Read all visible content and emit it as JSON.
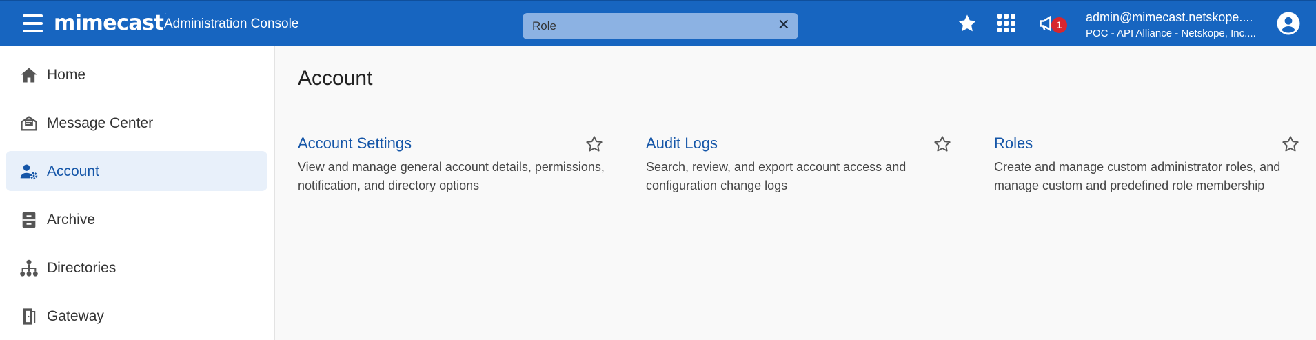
{
  "header": {
    "brand": "mimecast",
    "brand_mark": "·",
    "console_title": "Administration Console",
    "search": {
      "value": "Role",
      "placeholder": ""
    },
    "notification_count": "1",
    "user_email": "admin@mimecast.netskope....",
    "user_org": "POC - API Alliance - Netskope, Inc....",
    "colors": {
      "bar": "#1765c0",
      "search": "#8cb2e3",
      "badge": "#d7262e"
    }
  },
  "sidebar": {
    "items": [
      {
        "label": "Home",
        "icon": "home-icon",
        "active": false
      },
      {
        "label": "Message Center",
        "icon": "message-center-icon",
        "active": false
      },
      {
        "label": "Account",
        "icon": "account-settings-icon",
        "active": true
      },
      {
        "label": "Archive",
        "icon": "archive-icon",
        "active": false
      },
      {
        "label": "Directories",
        "icon": "directories-icon",
        "active": false
      },
      {
        "label": "Gateway",
        "icon": "gateway-icon",
        "active": false
      }
    ]
  },
  "main": {
    "title": "Account",
    "cards": [
      {
        "title": "Account Settings",
        "description": "View and manage general account details, permissions, notification, and directory options"
      },
      {
        "title": "Audit Logs",
        "description": "Search, review, and export account access and configuration change logs"
      },
      {
        "title": "Roles",
        "description": "Create and manage custom administrator roles, and manage custom and predefined role membership"
      }
    ]
  }
}
